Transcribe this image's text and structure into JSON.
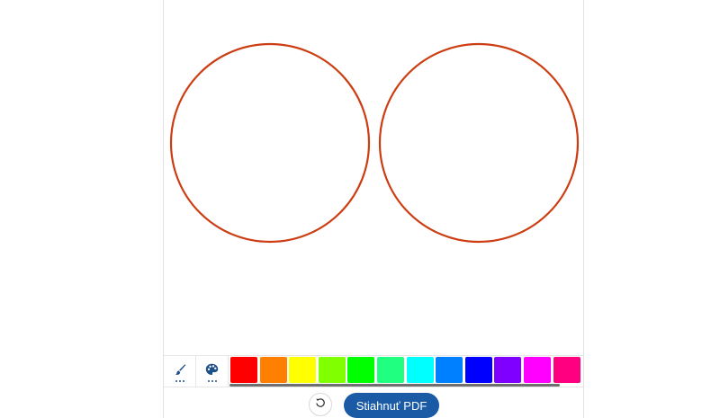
{
  "canvas": {
    "stroke_color": "#cc3d12",
    "shapes": [
      {
        "name": "left-circle"
      },
      {
        "name": "right-circle"
      }
    ]
  },
  "toolbar": {
    "brush_icon": "paintbrush-icon",
    "palette_icon": "palette-icon",
    "colors": [
      "#ff0000",
      "#ff8000",
      "#ffff00",
      "#80ff00",
      "#00ff00",
      "#20ff80",
      "#00ffff",
      "#0080ff",
      "#0000ff",
      "#8000ff",
      "#ff00ff",
      "#ff0080"
    ]
  },
  "actions": {
    "reset_icon": "reset-icon",
    "download_label": "Stiahnuť PDF"
  }
}
